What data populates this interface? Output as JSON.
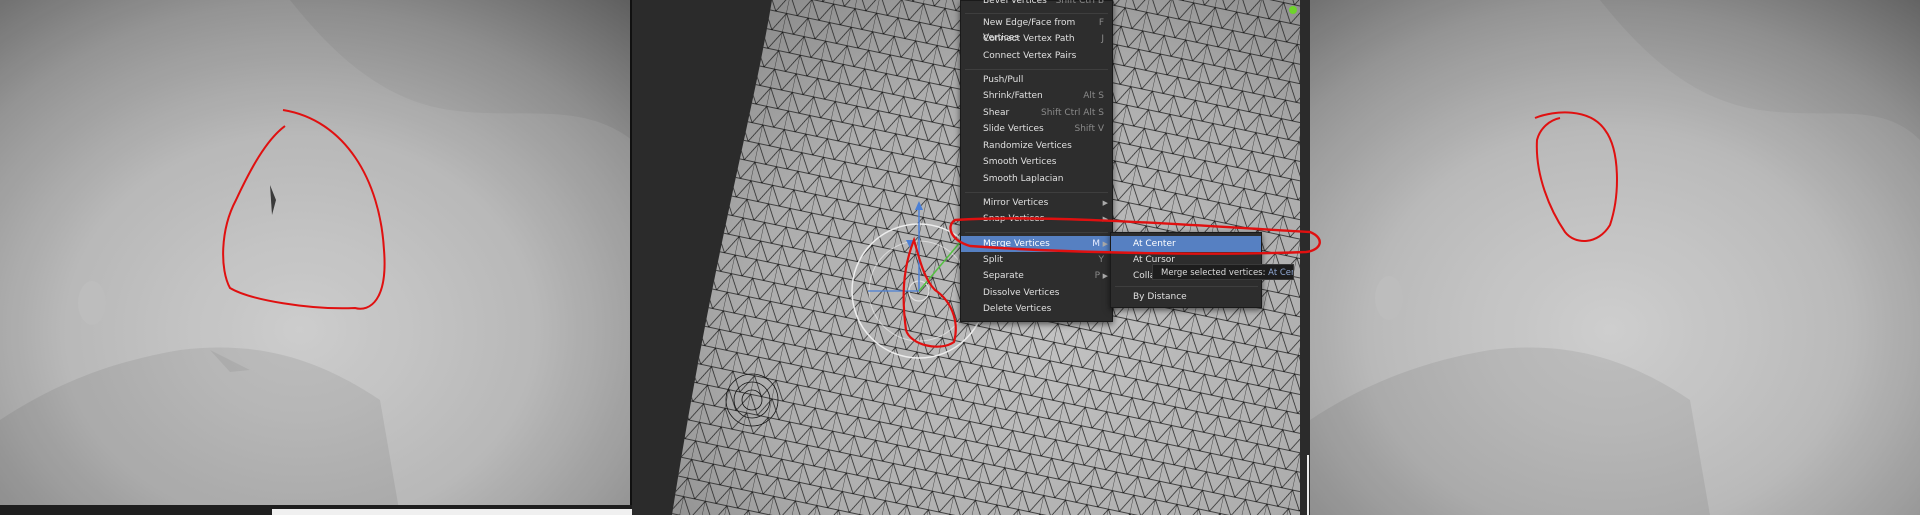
{
  "menu": {
    "items": [
      {
        "label": "Bevel Vertices",
        "shortcut": "Shift Ctrl B",
        "group": 0
      },
      {
        "label": "New Edge/Face from Vertices",
        "shortcut": "F",
        "group": 0
      },
      {
        "label": "Connect Vertex Path",
        "shortcut": "J",
        "group": 0
      },
      {
        "label": "Connect Vertex Pairs",
        "shortcut": "",
        "group": 0
      },
      {
        "label": "Push/Pull",
        "shortcut": "",
        "group": 1
      },
      {
        "label": "Shrink/Fatten",
        "shortcut": "Alt S",
        "group": 1
      },
      {
        "label": "Shear",
        "shortcut": "Shift Ctrl Alt S",
        "group": 1
      },
      {
        "label": "Slide Vertices",
        "shortcut": "Shift V",
        "group": 1
      },
      {
        "label": "Randomize Vertices",
        "shortcut": "",
        "group": 1
      },
      {
        "label": "Smooth Vertices",
        "shortcut": "",
        "group": 1
      },
      {
        "label": "Smooth Laplacian",
        "shortcut": "",
        "group": 1
      },
      {
        "label": "Mirror Vertices",
        "shortcut": "",
        "group": 2,
        "submenu": true
      },
      {
        "label": "Snap Vertices",
        "shortcut": "",
        "group": 2,
        "submenu": true
      },
      {
        "label": "Merge Vertices",
        "shortcut": "M",
        "group": 3,
        "submenu": true,
        "highlighted": true
      },
      {
        "label": "Split",
        "shortcut": "Y",
        "group": 3
      },
      {
        "label": "Separate",
        "shortcut": "P",
        "group": 3,
        "submenu": true
      },
      {
        "label": "Dissolve Vertices",
        "shortcut": "",
        "group": 3
      },
      {
        "label": "Delete Vertices",
        "shortcut": "",
        "group": 3
      }
    ]
  },
  "submenu": {
    "items": [
      {
        "label": "At Center",
        "highlighted": true
      },
      {
        "label": "At Cursor"
      },
      {
        "label": "Collapse"
      },
      {
        "label": "By Distance"
      }
    ]
  },
  "tooltip": {
    "text": "Merge selected vertices:",
    "value": "At Center"
  },
  "colors": {
    "highlight": "#5680c2",
    "menu_bg": "#2d2d2d",
    "annotation": "#e01010"
  }
}
